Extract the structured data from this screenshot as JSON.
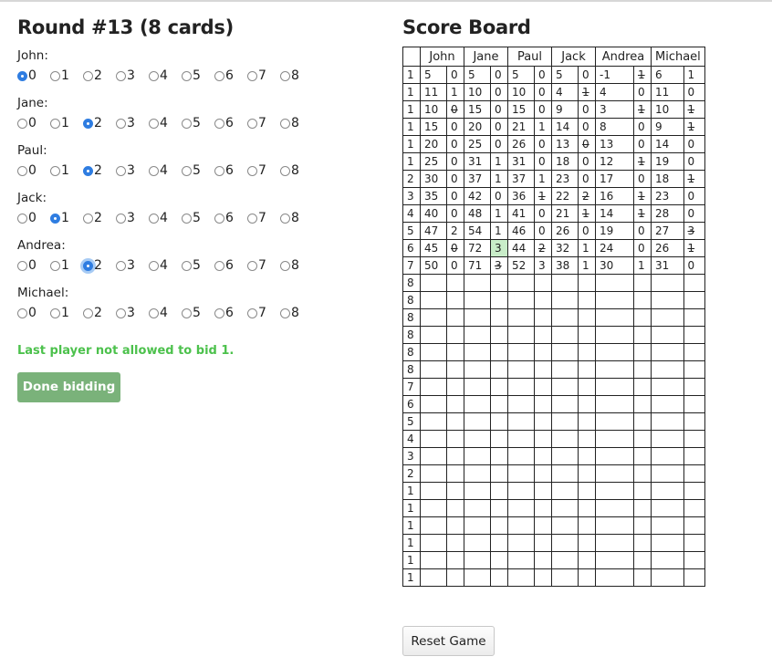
{
  "round_title": "Round #13 (8 cards)",
  "bid_options": [
    "0",
    "1",
    "2",
    "3",
    "4",
    "5",
    "6",
    "7",
    "8"
  ],
  "players": [
    {
      "name": "John:",
      "selected": 0
    },
    {
      "name": "Jane:",
      "selected": 2
    },
    {
      "name": "Paul:",
      "selected": 2
    },
    {
      "name": "Jack:",
      "selected": 1
    },
    {
      "name": "Andrea:",
      "selected": 2,
      "focused": true
    },
    {
      "name": "Michael:",
      "selected": null
    }
  ],
  "warning": "Last player not allowed to bid 1.",
  "done_button": "Done bidding",
  "scoreboard": {
    "title": "Score Board",
    "headers": [
      "John",
      "Jane",
      "Paul",
      "Jack",
      "Andrea",
      "Michael"
    ],
    "rows": [
      {
        "round": "1",
        "cells": [
          "5",
          "0",
          "5",
          "0",
          "5",
          "0",
          "5",
          "0",
          "-1",
          "1̶",
          "6",
          "1"
        ]
      },
      {
        "round": "1",
        "cells": [
          "11",
          "1",
          "10",
          "0",
          "10",
          "0",
          "4",
          "1̶",
          "4",
          "0",
          "11",
          "0"
        ]
      },
      {
        "round": "1",
        "cells": [
          "10",
          "0̶",
          "15",
          "0",
          "15",
          "0",
          "9",
          "0",
          "3",
          "1̶",
          "10",
          "1̶"
        ]
      },
      {
        "round": "1",
        "cells": [
          "15",
          "0",
          "20",
          "0",
          "21",
          "1",
          "14",
          "0",
          "8",
          "0",
          "9",
          "1̶"
        ]
      },
      {
        "round": "1",
        "cells": [
          "20",
          "0",
          "25",
          "0",
          "26",
          "0",
          "13",
          "0̶",
          "13",
          "0",
          "14",
          "0"
        ]
      },
      {
        "round": "1",
        "cells": [
          "25",
          "0",
          "31",
          "1",
          "31",
          "0",
          "18",
          "0",
          "12",
          "1̶",
          "19",
          "0"
        ]
      },
      {
        "round": "2",
        "cells": [
          "30",
          "0",
          "37",
          "1",
          "37",
          "1",
          "23",
          "0",
          "17",
          "0",
          "18",
          "1̶"
        ]
      },
      {
        "round": "3",
        "cells": [
          "35",
          "0",
          "42",
          "0",
          "36",
          "1̶",
          "22",
          "2̶",
          "16",
          "1̶",
          "23",
          "0"
        ]
      },
      {
        "round": "4",
        "cells": [
          "40",
          "0",
          "48",
          "1",
          "41",
          "0",
          "21",
          "1̶",
          "14",
          "1̶",
          "28",
          "0"
        ]
      },
      {
        "round": "5",
        "cells": [
          "47",
          "2",
          "54",
          "1",
          "46",
          "0",
          "26",
          "0",
          "19",
          "0",
          "27",
          "3̶"
        ]
      },
      {
        "round": "6",
        "cells": [
          "45",
          "0̶",
          "72",
          "3",
          "44",
          "2̶",
          "32",
          "1",
          "24",
          "0",
          "26",
          "1̶"
        ]
      },
      {
        "round": "7",
        "cells": [
          "50",
          "0",
          "71",
          "3̶",
          "52",
          "3",
          "38",
          "1",
          "30",
          "1",
          "31",
          "0"
        ]
      },
      {
        "round": "8",
        "cells": [
          "",
          "",
          "",
          "",
          "",
          "",
          "",
          "",
          "",
          "",
          "",
          ""
        ]
      },
      {
        "round": "8",
        "cells": [
          "",
          "",
          "",
          "",
          "",
          "",
          "",
          "",
          "",
          "",
          "",
          ""
        ]
      },
      {
        "round": "8",
        "cells": [
          "",
          "",
          "",
          "",
          "",
          "",
          "",
          "",
          "",
          "",
          "",
          ""
        ]
      },
      {
        "round": "8",
        "cells": [
          "",
          "",
          "",
          "",
          "",
          "",
          "",
          "",
          "",
          "",
          "",
          ""
        ]
      },
      {
        "round": "8",
        "cells": [
          "",
          "",
          "",
          "",
          "",
          "",
          "",
          "",
          "",
          "",
          "",
          ""
        ]
      },
      {
        "round": "8",
        "cells": [
          "",
          "",
          "",
          "",
          "",
          "",
          "",
          "",
          "",
          "",
          "",
          ""
        ]
      },
      {
        "round": "7",
        "cells": [
          "",
          "",
          "",
          "",
          "",
          "",
          "",
          "",
          "",
          "",
          "",
          ""
        ]
      },
      {
        "round": "6",
        "cells": [
          "",
          "",
          "",
          "",
          "",
          "",
          "",
          "",
          "",
          "",
          "",
          ""
        ]
      },
      {
        "round": "5",
        "cells": [
          "",
          "",
          "",
          "",
          "",
          "",
          "",
          "",
          "",
          "",
          "",
          ""
        ]
      },
      {
        "round": "4",
        "cells": [
          "",
          "",
          "",
          "",
          "",
          "",
          "",
          "",
          "",
          "",
          "",
          ""
        ]
      },
      {
        "round": "3",
        "cells": [
          "",
          "",
          "",
          "",
          "",
          "",
          "",
          "",
          "",
          "",
          "",
          ""
        ]
      },
      {
        "round": "2",
        "cells": [
          "",
          "",
          "",
          "",
          "",
          "",
          "",
          "",
          "",
          "",
          "",
          ""
        ]
      },
      {
        "round": "1",
        "cells": [
          "",
          "",
          "",
          "",
          "",
          "",
          "",
          "",
          "",
          "",
          "",
          ""
        ]
      },
      {
        "round": "1",
        "cells": [
          "",
          "",
          "",
          "",
          "",
          "",
          "",
          "",
          "",
          "",
          "",
          ""
        ]
      },
      {
        "round": "1",
        "cells": [
          "",
          "",
          "",
          "",
          "",
          "",
          "",
          "",
          "",
          "",
          "",
          ""
        ]
      },
      {
        "round": "1",
        "cells": [
          "",
          "",
          "",
          "",
          "",
          "",
          "",
          "",
          "",
          "",
          "",
          ""
        ]
      },
      {
        "round": "1",
        "cells": [
          "",
          "",
          "",
          "",
          "",
          "",
          "",
          "",
          "",
          "",
          "",
          ""
        ]
      },
      {
        "round": "1",
        "cells": [
          "",
          "",
          "",
          "",
          "",
          "",
          "",
          "",
          "",
          "",
          "",
          ""
        ]
      }
    ],
    "highlight": {
      "row": 10,
      "col": 3,
      "color": "#c9edc9"
    }
  },
  "reset_button": "Reset Game",
  "colors": {
    "accent": "#2f7de1",
    "warning": "#4cc14c",
    "done_button": "#7ab27a"
  }
}
